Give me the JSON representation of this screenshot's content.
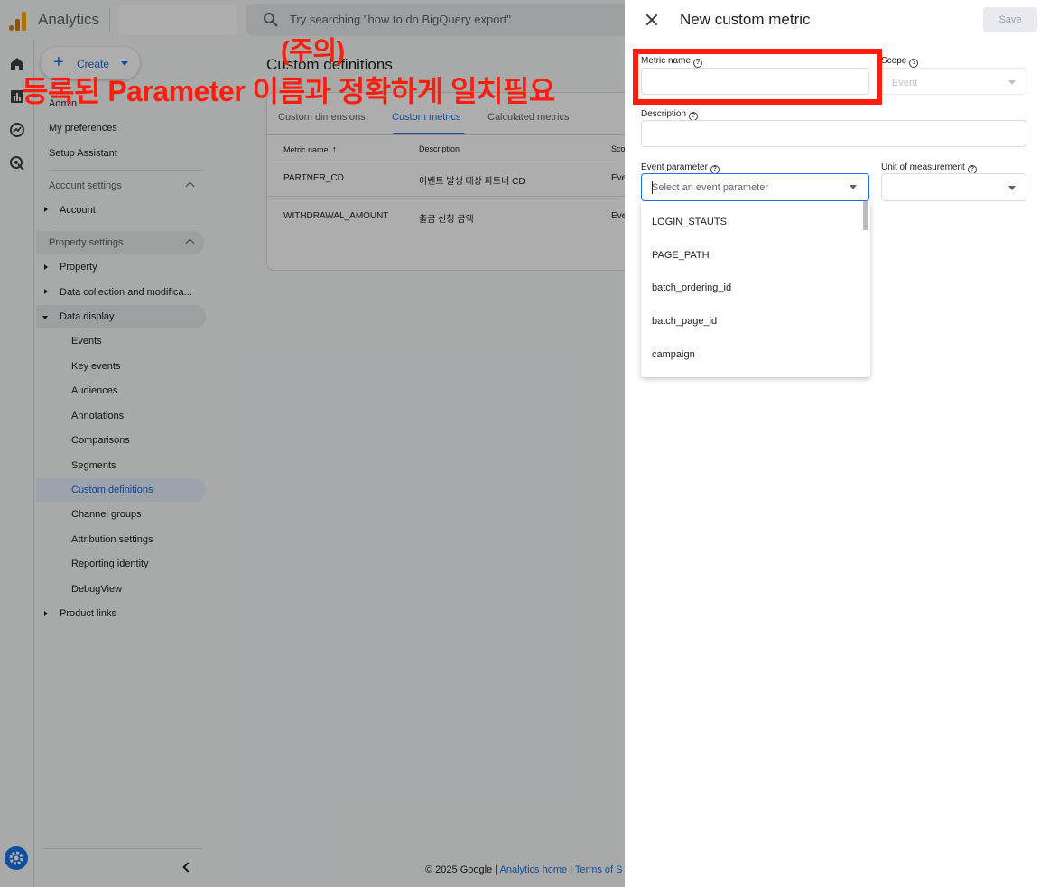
{
  "app": {
    "name": "Analytics",
    "search_placeholder": "Try searching \"how to do BigQuery export\""
  },
  "colors": {
    "accent": "#1a73e8",
    "annotation_red": "#ff1e0e",
    "logo_orange": "#f9ab00",
    "logo_dark_orange": "#e37400"
  },
  "rail_icons": [
    "home-icon",
    "reports-icon",
    "explore-icon",
    "advertising-icon",
    "settings-gear-icon"
  ],
  "nav": {
    "create_label": "Create",
    "admin": "Admin",
    "my_preferences": "My preferences",
    "setup_assistant": "Setup Assistant",
    "account_settings": "Account settings",
    "account": "Account",
    "property_settings": "Property settings",
    "property": "Property",
    "data_collection": "Data collection and modifica...",
    "data_display": "Data display",
    "data_display_items": [
      "Events",
      "Key events",
      "Audiences",
      "Annotations",
      "Comparisons",
      "Segments",
      "Custom definitions",
      "Channel groups",
      "Attribution settings",
      "Reporting identity",
      "DebugView"
    ],
    "product_links": "Product links"
  },
  "main": {
    "title": "Custom definitions",
    "tabs": [
      "Custom dimensions",
      "Custom metrics",
      "Calculated metrics"
    ],
    "active_tab": "Custom metrics",
    "columns": [
      "Metric name",
      "Description",
      "Sco"
    ],
    "rows": [
      {
        "name": "PARTNER_CD",
        "description": "이벤트 발생 대상 파트너 CD",
        "scope": "Eve"
      },
      {
        "name": "WITHDRAWAL_AMOUNT",
        "description": "출금 신청 금액",
        "scope": "Eve"
      }
    ]
  },
  "footer": {
    "copyright": "© 2025 Google |",
    "home_link": "Analytics home",
    "sep": "|",
    "terms": "Terms of S"
  },
  "annotation": {
    "line1": "(주의)",
    "line2": "등록된 Parameter 이름과 정확하게 일치필요"
  },
  "panel": {
    "title": "New custom metric",
    "save_label": "Save",
    "metric_name_label": "Metric name",
    "metric_name_value": "",
    "scope_label": "Scope",
    "scope_value": "Event",
    "description_label": "Description",
    "description_value": "",
    "event_parameter_label": "Event parameter",
    "event_parameter_placeholder": "Select an event parameter",
    "unit_label": "Unit of measurement",
    "unit_value": "",
    "dropdown_options": [
      "LOGIN_STAUTS",
      "PAGE_PATH",
      "batch_ordering_id",
      "batch_page_id",
      "campaign"
    ]
  }
}
